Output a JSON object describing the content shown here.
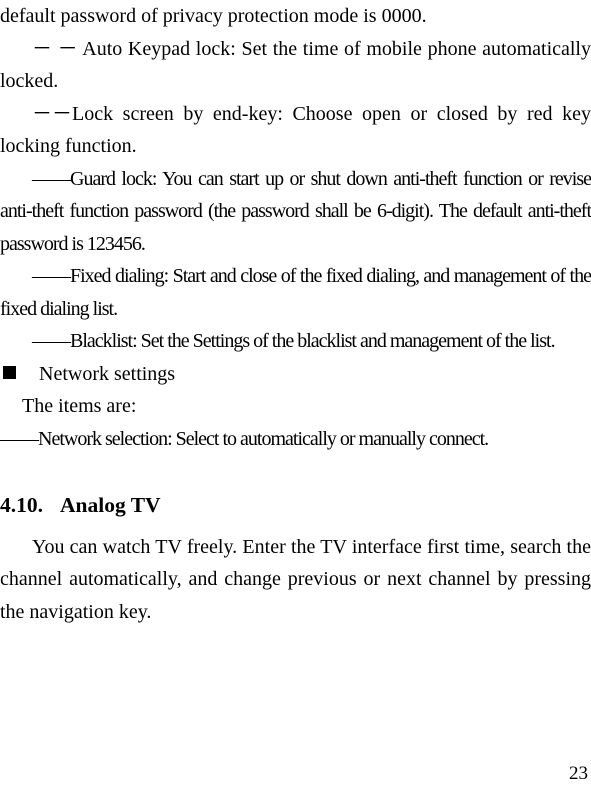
{
  "document": {
    "page_number": "23",
    "section_heading": {
      "number": "4.10.",
      "title": "Analog TV"
    },
    "paragraphs": {
      "continuation": "default password of privacy protection mode is 0000.",
      "auto_keypad_lock": "－ － Auto Keypad lock: Set the time of mobile phone automatically locked.",
      "lock_screen_end_key": "－－Lock screen by end-key: Choose open or closed by red key locking function.",
      "guard_lock": "——Guard lock: You can start up or shut down anti-theft function or revise anti-theft function password (the password shall be 6-digit). The default anti-theft password is 123456.",
      "fixed_dialing": "——Fixed dialing: Start and close of the fixed dialing, and management of the fixed dialing list.",
      "blacklist": "——Blacklist: Set the Settings of the blacklist and management of the list.",
      "network_settings_bullet": "Network settings",
      "items_are": "The items are:",
      "network_selection": "——Network selection: Select to automatically or manually connect.",
      "analog_tv_body": "You can watch TV freely. Enter the TV interface first time, search the channel automatically, and change previous or next channel by pressing the navigation key."
    }
  }
}
